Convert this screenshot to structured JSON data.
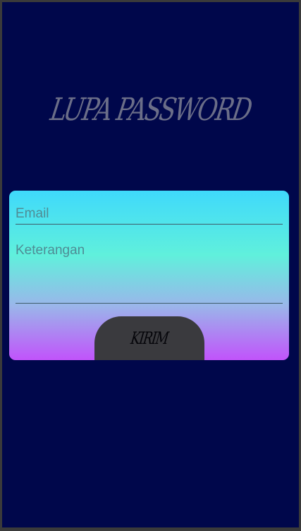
{
  "screen": {
    "title": "LUPA PASSWORD"
  },
  "form": {
    "email_placeholder": "Email",
    "email_value": "",
    "keterangan_placeholder": "Keterangan",
    "keterangan_value": "",
    "submit_label": "KIRIM"
  },
  "colors": {
    "background": "#00074b",
    "title": "#6b6e88",
    "card_gradient_top": "#3fd9fb",
    "card_gradient_mid": "#60f0dc",
    "card_gradient_bottom": "#c153fb",
    "button_bg": "#3a3a3e"
  }
}
